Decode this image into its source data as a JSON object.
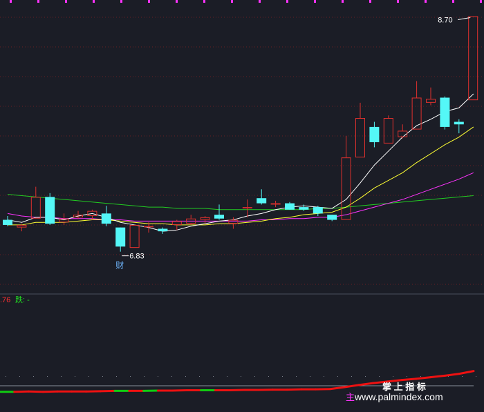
{
  "colors": {
    "background": "#1b1d26",
    "grid": "#6a1f24",
    "up": "#e0312e",
    "down": "#54f7f7",
    "ma5": "#ffffff",
    "ma10": "#ffff33",
    "ma20": "#ff33ff",
    "ma60": "#22cc22",
    "indicator_up": "#ee1111",
    "indicator_down": "#11cc11",
    "watermark": "#ffffff",
    "top_marks": "#ff33ff"
  },
  "chart_data": {
    "type": "candlestick",
    "ylim": [
      6.55,
      8.8
    ],
    "candles": [
      {
        "o": 7.1,
        "h": 7.13,
        "l": 7.05,
        "c": 7.06
      },
      {
        "o": 7.04,
        "h": 7.07,
        "l": 7.01,
        "c": 7.06
      },
      {
        "o": 7.11,
        "h": 7.36,
        "l": 7.11,
        "c": 7.28
      },
      {
        "o": 7.28,
        "h": 7.31,
        "l": 7.06,
        "c": 7.07
      },
      {
        "o": 7.08,
        "h": 7.15,
        "l": 7.06,
        "c": 7.11
      },
      {
        "o": 7.12,
        "h": 7.17,
        "l": 7.11,
        "c": 7.14
      },
      {
        "o": 7.13,
        "h": 7.18,
        "l": 7.1,
        "c": 7.17
      },
      {
        "o": 7.15,
        "h": 7.21,
        "l": 7.05,
        "c": 7.07
      },
      {
        "o": 7.04,
        "h": 7.04,
        "l": 6.85,
        "c": 6.89
      },
      {
        "o": 6.88,
        "h": 7.06,
        "l": 6.88,
        "c": 7.06
      },
      {
        "o": 7.05,
        "h": 7.08,
        "l": 7.0,
        "c": 7.05
      },
      {
        "o": 7.03,
        "h": 7.04,
        "l": 6.99,
        "c": 7.01
      },
      {
        "o": 7.06,
        "h": 7.1,
        "l": 7.02,
        "c": 7.09
      },
      {
        "o": 7.07,
        "h": 7.14,
        "l": 7.06,
        "c": 7.11
      },
      {
        "o": 7.1,
        "h": 7.13,
        "l": 7.07,
        "c": 7.12
      },
      {
        "o": 7.14,
        "h": 7.22,
        "l": 7.1,
        "c": 7.11
      },
      {
        "o": 7.07,
        "h": 7.12,
        "l": 7.03,
        "c": 7.1
      },
      {
        "o": 7.19,
        "h": 7.26,
        "l": 7.12,
        "c": 7.2
      },
      {
        "o": 7.27,
        "h": 7.34,
        "l": 7.22,
        "c": 7.23
      },
      {
        "o": 7.22,
        "h": 7.25,
        "l": 7.2,
        "c": 7.23
      },
      {
        "o": 7.23,
        "h": 7.24,
        "l": 7.18,
        "c": 7.18
      },
      {
        "o": 7.2,
        "h": 7.22,
        "l": 7.17,
        "c": 7.18
      },
      {
        "o": 7.2,
        "h": 7.21,
        "l": 7.13,
        "c": 7.15
      },
      {
        "o": 7.14,
        "h": 7.14,
        "l": 7.09,
        "c": 7.1
      },
      {
        "o": 7.1,
        "h": 7.76,
        "l": 7.1,
        "c": 7.59
      },
      {
        "o": 7.59,
        "h": 8.02,
        "l": 7.59,
        "c": 7.9
      },
      {
        "o": 7.83,
        "h": 7.87,
        "l": 7.67,
        "c": 7.71
      },
      {
        "o": 7.7,
        "h": 7.92,
        "l": 7.7,
        "c": 7.9
      },
      {
        "o": 7.75,
        "h": 7.85,
        "l": 7.74,
        "c": 7.8
      },
      {
        "o": 7.81,
        "h": 8.19,
        "l": 7.81,
        "c": 8.06
      },
      {
        "o": 8.02,
        "h": 8.14,
        "l": 8.0,
        "c": 8.05
      },
      {
        "o": 8.06,
        "h": 8.07,
        "l": 7.81,
        "c": 7.83
      },
      {
        "o": 7.87,
        "h": 7.89,
        "l": 7.78,
        "c": 7.85
      },
      {
        "o": 8.04,
        "h": 8.7,
        "l": 8.04,
        "c": 8.7
      }
    ],
    "ma5": [
      7.1,
      7.08,
      7.12,
      7.12,
      7.1,
      7.13,
      7.15,
      7.12,
      7.08,
      7.06,
      7.04,
      7.01,
      7.02,
      7.05,
      7.07,
      7.09,
      7.1,
      7.13,
      7.15,
      7.18,
      7.2,
      7.21,
      7.2,
      7.19,
      7.26,
      7.39,
      7.53,
      7.64,
      7.75,
      7.84,
      7.89,
      7.95,
      7.98,
      8.09
    ],
    "ma10": [
      7.06,
      7.06,
      7.08,
      7.08,
      7.08,
      7.09,
      7.1,
      7.1,
      7.09,
      7.08,
      7.07,
      7.07,
      7.06,
      7.06,
      7.06,
      7.07,
      7.07,
      7.08,
      7.09,
      7.11,
      7.12,
      7.14,
      7.15,
      7.16,
      7.2,
      7.27,
      7.35,
      7.41,
      7.47,
      7.55,
      7.62,
      7.69,
      7.75,
      7.83
    ],
    "ma20": [
      7.15,
      7.13,
      7.12,
      7.12,
      7.11,
      7.11,
      7.11,
      7.1,
      7.1,
      7.09,
      7.09,
      7.09,
      7.09,
      7.09,
      7.09,
      7.09,
      7.09,
      7.09,
      7.1,
      7.1,
      7.11,
      7.11,
      7.12,
      7.12,
      7.14,
      7.17,
      7.2,
      7.23,
      7.26,
      7.3,
      7.34,
      7.38,
      7.42,
      7.47
    ],
    "ma60": [
      7.3,
      7.29,
      7.28,
      7.27,
      7.26,
      7.25,
      7.24,
      7.23,
      7.22,
      7.21,
      7.2,
      7.2,
      7.19,
      7.19,
      7.19,
      7.18,
      7.18,
      7.18,
      7.18,
      7.18,
      7.18,
      7.18,
      7.19,
      7.19,
      7.2,
      7.21,
      7.22,
      7.23,
      7.24,
      7.25,
      7.26,
      7.27,
      7.28,
      7.29
    ],
    "annotations": {
      "high_label": "8.70",
      "low_label": "6.83",
      "low_marker": "财"
    },
    "indicator": {
      "label_prefix": ".76",
      "label_fall": "跌: -",
      "baseline_ylim": [
        0,
        1
      ],
      "line": [
        0.05,
        0.05,
        0.06,
        0.05,
        0.06,
        0.06,
        0.06,
        0.07,
        0.08,
        0.08,
        0.08,
        0.09,
        0.09,
        0.1,
        0.1,
        0.1,
        0.1,
        0.11,
        0.11,
        0.12,
        0.12,
        0.13,
        0.13,
        0.14,
        0.2,
        0.27,
        0.33,
        0.38,
        0.43,
        0.47,
        0.52,
        0.57,
        0.63,
        0.72
      ],
      "down_segments": [
        [
          0,
          1
        ],
        [
          8,
          9
        ],
        [
          10,
          11
        ],
        [
          14,
          15
        ]
      ]
    }
  },
  "watermark": {
    "title": "掌 上 指 标",
    "url": "www.palmindex.com",
    "side_char": "主"
  }
}
